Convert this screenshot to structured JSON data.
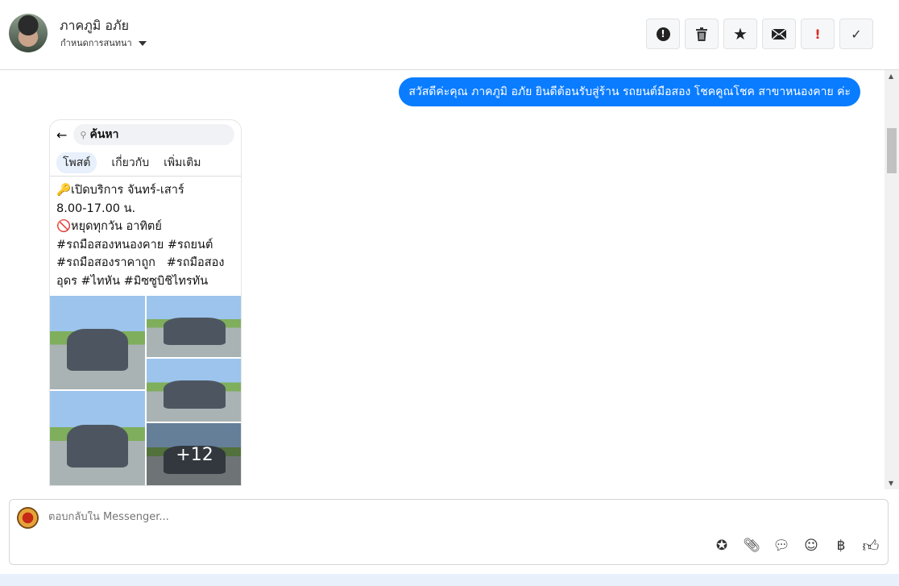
{
  "header": {
    "contact_name": "ภาคภูมิ อภัย",
    "assign_label": "กำหนดการสนทนา",
    "actions": [
      {
        "icon": "alert-circle-icon",
        "glyph": "!"
      },
      {
        "icon": "trash-icon",
        "glyph": "🗑"
      },
      {
        "icon": "star-icon",
        "glyph": "★"
      },
      {
        "icon": "envelope-icon",
        "glyph": "✉"
      },
      {
        "icon": "exclamation-icon",
        "glyph": "!"
      },
      {
        "icon": "check-icon",
        "glyph": "✓"
      }
    ]
  },
  "conversation": {
    "outgoing_message": "สวัสดีค่ะคุณ ภาคภูมิ อภัย ยินดีต้อนรับสู่ร้าน รถยนต์มือสอง โชคคูณโชค สาขาหนองคาย ค่ะ",
    "attachment": {
      "search_text": "ค้นหา",
      "tabs": [
        "โพสต์",
        "เกี่ยวกับ",
        "เพิ่มเติม"
      ],
      "lines": [
        "🔑เปิดบริการ จันทร์-เสาร์",
        "8.00-17.00 น.",
        "🚫หยุดทุกวัน อาทิตย์",
        "#รถมือสองหนองคาย #รถยนต์",
        "#รถมือสองราคาถูก   #รถมือสอง",
        "อุดร #ไทหัน #มิซซูบิชิไทรทัน"
      ],
      "more_photos": "+12"
    }
  },
  "composer": {
    "placeholder": "ตอบกลับใน Messenger..."
  },
  "colors": {
    "accent": "#0a7cff",
    "danger": "#d93025"
  }
}
